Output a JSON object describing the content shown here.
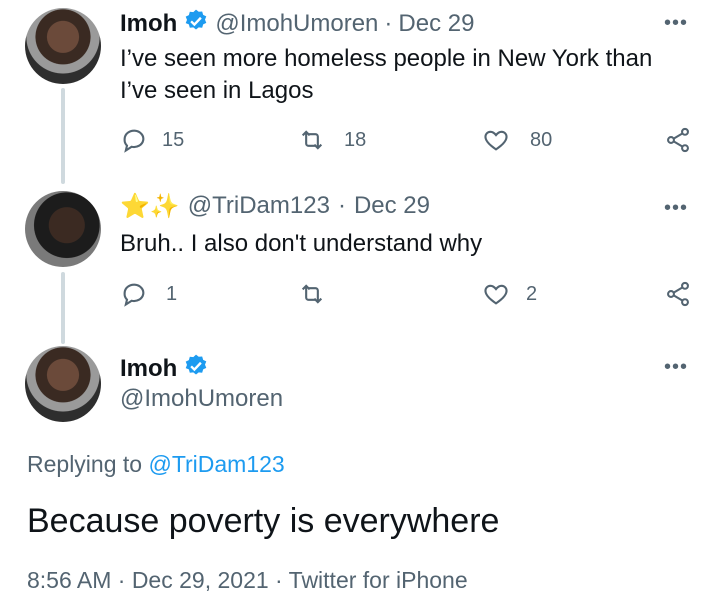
{
  "tweet1": {
    "name": "Imoh",
    "handle": "@ImohUmoren",
    "sep": "·",
    "date": "Dec 29",
    "text": "I’ve seen more homeless people in New York than I’ve seen in Lagos",
    "replies": "15",
    "retweets": "18",
    "likes": "80",
    "more": "•••"
  },
  "tweet2": {
    "name_emoji": "⭐✨",
    "handle": "@TriDam123",
    "sep": "·",
    "date": "Dec 29",
    "text": "Bruh.. I also don't understand why",
    "replies": "1",
    "likes": "2",
    "more": "•••"
  },
  "main": {
    "name": "Imoh",
    "handle": "@ImohUmoren",
    "replying_to": "Replying to",
    "replying_handle": "@TriDam123",
    "text": "Because poverty is everywhere",
    "meta": "8:56 AM · Dec 29, 2021 · Twitter for iPhone",
    "more": "•••"
  },
  "colors": {
    "accent": "#1d9bf0",
    "muted": "#536471",
    "line": "#cfd9de"
  }
}
